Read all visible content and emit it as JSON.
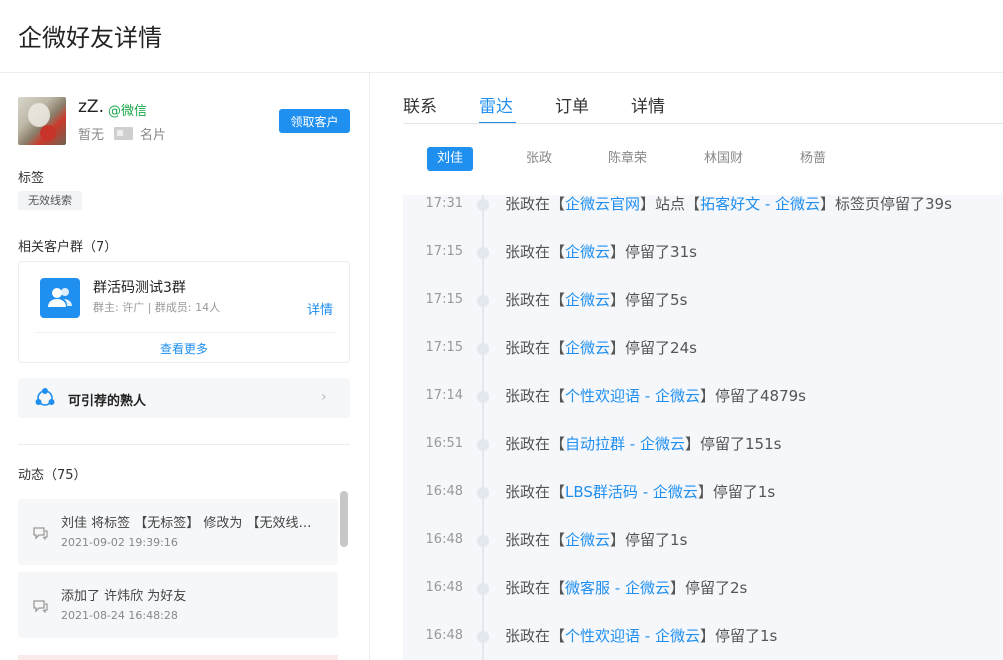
{
  "page": {
    "title": "企微好友详情"
  },
  "profile": {
    "nickname": "zZ.",
    "source_tag": "@微信",
    "note": "暂无",
    "card_label": "名片",
    "claim_button": "领取客户"
  },
  "tags": {
    "label": "标签",
    "items": [
      "无效线索"
    ]
  },
  "groups": {
    "label": "相关客户群（7）",
    "card": {
      "name": "群活码测试3群",
      "meta": "群主: 许广 | 群成员: 14人",
      "detail_link": "详情",
      "see_more": "查看更多"
    }
  },
  "recommend": {
    "label": "可引荐的熟人"
  },
  "activity": {
    "label": "动态（75）",
    "items": [
      {
        "text": "刘佳 将标签 【无标签】 修改为 【无效线索】",
        "time": "2021-09-02 19:39:16"
      },
      {
        "text": "添加了 许炜欣 为好友",
        "time": "2021-08-24 16:48:28"
      }
    ]
  },
  "tabs": [
    {
      "label": "联系",
      "active": false
    },
    {
      "label": "雷达",
      "active": true
    },
    {
      "label": "订单",
      "active": false
    },
    {
      "label": "详情",
      "active": false
    }
  ],
  "people": [
    {
      "name": "刘佳",
      "active": true
    },
    {
      "name": "张政",
      "active": false
    },
    {
      "name": "陈章荣",
      "active": false
    },
    {
      "name": "林国财",
      "active": false
    },
    {
      "name": "杨蔷",
      "active": false
    }
  ],
  "timeline": [
    {
      "time": "17:31",
      "prefix": "张政在",
      "parts": [
        [
          "【",
          ""
        ],
        [
          "企微云官网",
          "link"
        ],
        [
          "】站点【",
          ""
        ],
        [
          "拓客好文 - 企微云",
          "link"
        ],
        [
          "】标签页停留了39s",
          ""
        ]
      ]
    },
    {
      "time": "17:15",
      "prefix": "张政在",
      "parts": [
        [
          "【",
          ""
        ],
        [
          "企微云",
          "link"
        ],
        [
          "】停留了31s",
          ""
        ]
      ]
    },
    {
      "time": "17:15",
      "prefix": "张政在",
      "parts": [
        [
          "【",
          ""
        ],
        [
          "企微云",
          "link"
        ],
        [
          "】停留了5s",
          ""
        ]
      ]
    },
    {
      "time": "17:15",
      "prefix": "张政在",
      "parts": [
        [
          "【",
          ""
        ],
        [
          "企微云",
          "link"
        ],
        [
          "】停留了24s",
          ""
        ]
      ]
    },
    {
      "time": "17:14",
      "prefix": "张政在",
      "parts": [
        [
          "【",
          ""
        ],
        [
          "个性欢迎语 - 企微云",
          "link"
        ],
        [
          "】停留了4879s",
          ""
        ]
      ]
    },
    {
      "time": "16:51",
      "prefix": "张政在",
      "parts": [
        [
          "【",
          ""
        ],
        [
          "自动拉群 - 企微云",
          "link"
        ],
        [
          "】停留了151s",
          ""
        ]
      ]
    },
    {
      "time": "16:48",
      "prefix": "张政在",
      "parts": [
        [
          "【",
          ""
        ],
        [
          "LBS群活码 - 企微云",
          "link"
        ],
        [
          "】停留了1s",
          ""
        ]
      ]
    },
    {
      "time": "16:48",
      "prefix": "张政在",
      "parts": [
        [
          "【",
          ""
        ],
        [
          "企微云",
          "link"
        ],
        [
          "】停留了1s",
          ""
        ]
      ]
    },
    {
      "time": "16:48",
      "prefix": "张政在",
      "parts": [
        [
          "【",
          ""
        ],
        [
          "微客服 - 企微云",
          "link"
        ],
        [
          "】停留了2s",
          ""
        ]
      ]
    },
    {
      "time": "16:48",
      "prefix": "张政在",
      "parts": [
        [
          "【",
          ""
        ],
        [
          "个性欢迎语 - 企微云",
          "link"
        ],
        [
          "】停留了1s",
          ""
        ]
      ]
    }
  ],
  "colors": {
    "accent": "#1f8ff0",
    "wechat_green": "#18a84a"
  }
}
